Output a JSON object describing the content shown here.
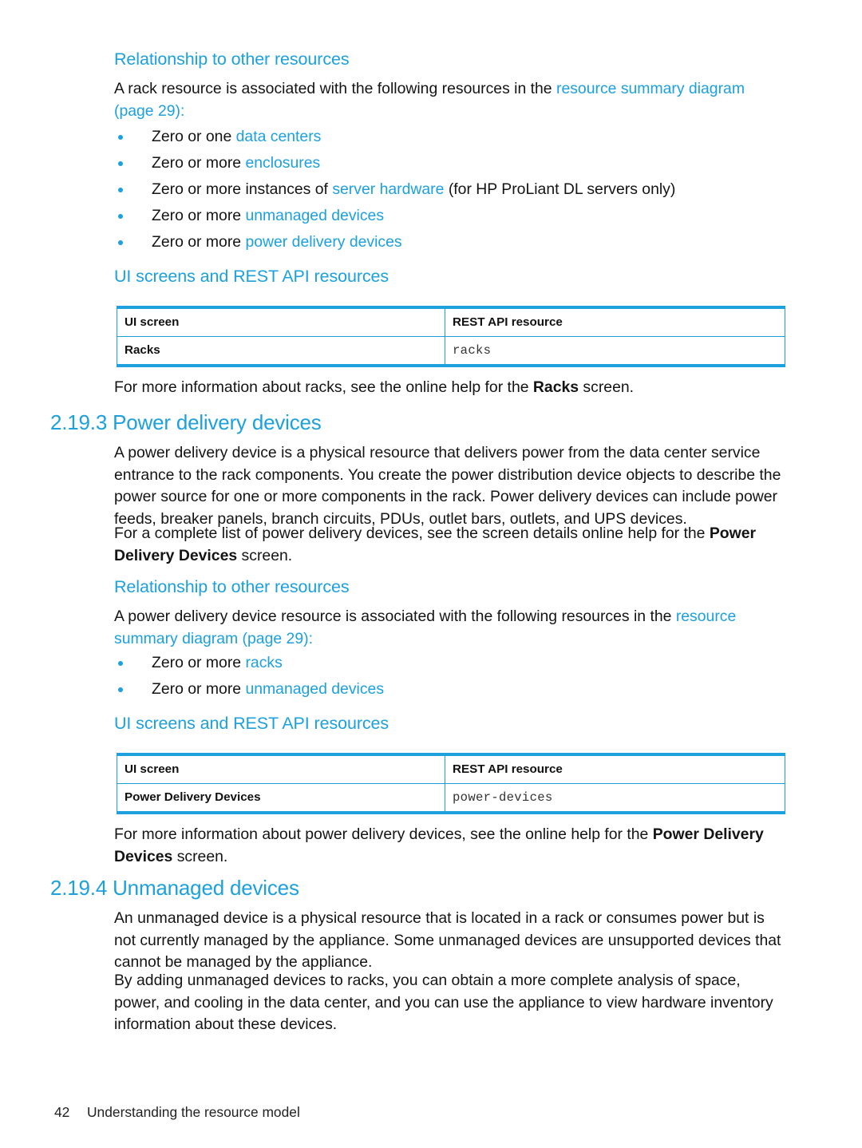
{
  "page": {
    "number": "42",
    "footer_title": "Understanding the resource model"
  },
  "colors": {
    "accent_blue": "#1CA0DE",
    "body_text": "#141414",
    "table_border": "#1CA0DE"
  },
  "sections": {
    "racks_tail": {
      "relationship_heading": "Relationship to other resources",
      "intro_1": "A rack resource is associated with the following resources in the ",
      "intro_link": "resource summary diagram (page 29)",
      "intro_2": ":",
      "bullets": [
        {
          "lead": "Zero or one ",
          "link": "data centers",
          "tail": ""
        },
        {
          "lead": "Zero or more ",
          "link": "enclosures",
          "tail": ""
        },
        {
          "lead": "Zero or more instances of ",
          "link": "server hardware",
          "tail": " (for HP ProLiant DL servers only)"
        },
        {
          "lead": "Zero or more ",
          "link": "unmanaged devices",
          "tail": ""
        },
        {
          "lead": "Zero or more ",
          "link": "power delivery devices",
          "tail": ""
        }
      ],
      "ui_rest_heading": "UI screens and REST API resources",
      "table": {
        "headers": [
          "UI screen",
          "REST API resource"
        ],
        "rows": [
          [
            "Racks",
            "racks"
          ]
        ]
      },
      "closing_1": "For more information about racks, see the online help for the ",
      "closing_bold": "Racks",
      "closing_2": " screen."
    },
    "power_delivery": {
      "number": "2.19.3",
      "title": "Power delivery devices",
      "heading_full": "2.19.3 Power delivery devices",
      "para_1": "A power delivery device is a physical resource that delivers power from the data center service entrance to the rack components. You create the power distribution device objects to describe the power source for one or more components in the rack. Power delivery devices can include power feeds, breaker panels, branch circuits, PDUs, outlet bars, outlets, and UPS devices.",
      "para_2_lead": "For a complete list of power delivery devices, see the screen details online help for the ",
      "para_2_bold": "Power Delivery Devices",
      "para_2_tail": " screen.",
      "relationship_heading": "Relationship to other resources",
      "intro_1": "A power delivery device resource is associated with the following resources in the ",
      "intro_link": "resource summary diagram (page 29)",
      "intro_2": ":",
      "bullets": [
        {
          "lead": "Zero or more ",
          "link": "racks",
          "tail": ""
        },
        {
          "lead": "Zero or more ",
          "link": "unmanaged devices",
          "tail": ""
        }
      ],
      "ui_rest_heading": "UI screens and REST API resources",
      "table": {
        "headers": [
          "UI screen",
          "REST API resource"
        ],
        "rows": [
          [
            "Power Delivery Devices",
            "power-devices"
          ]
        ]
      },
      "closing_1": "For more information about power delivery devices, see the online help for the ",
      "closing_bold": "Power Delivery Devices",
      "closing_2": " screen."
    },
    "unmanaged_devices": {
      "number": "2.19.4",
      "title": "Unmanaged devices",
      "heading_full": "2.19.4 Unmanaged devices",
      "para_1": "An unmanaged device is a physical resource that is located in a rack or consumes power but is not currently managed by the appliance. Some unmanaged devices are unsupported devices that cannot be managed by the appliance.",
      "para_2": "By adding unmanaged devices to racks, you can obtain a more complete analysis of space, power, and cooling in the data center, and you can use the appliance to view hardware inventory information about these devices."
    }
  }
}
